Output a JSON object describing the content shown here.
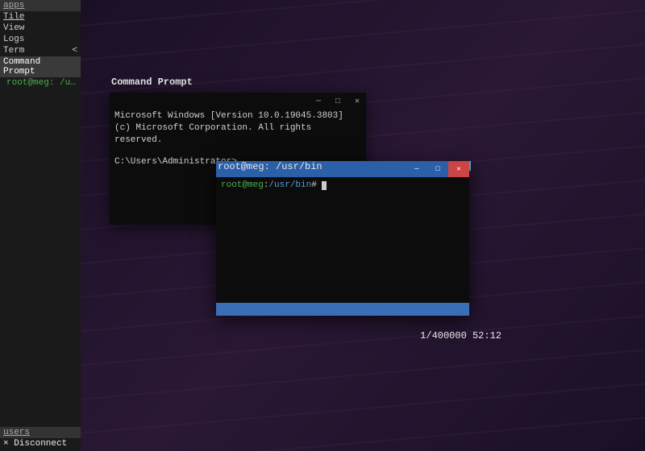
{
  "sidebar": {
    "header_apps": "apps",
    "items": [
      {
        "label": "Tile"
      },
      {
        "label": "View"
      },
      {
        "label": "Logs"
      },
      {
        "label": "Term",
        "chevron": "<"
      }
    ],
    "active": "Command Prompt",
    "sub": "root@meg: /usr…",
    "header_users": "users",
    "disconnect": "× Disconnect"
  },
  "cmd": {
    "title": "Command Prompt",
    "line1": "Microsoft Windows [Version 10.0.19045.3803]",
    "line2": "(c) Microsoft Corporation. All rights reserved.",
    "prompt": "C:\\Users\\Administrator>"
  },
  "linux": {
    "title": "root@meg: /usr/bin",
    "prompt_user": "root@meg",
    "prompt_sep": ":",
    "prompt_path": "/usr/bin",
    "prompt_end": "# "
  },
  "status": {
    "text": "1/400000 52:12"
  }
}
